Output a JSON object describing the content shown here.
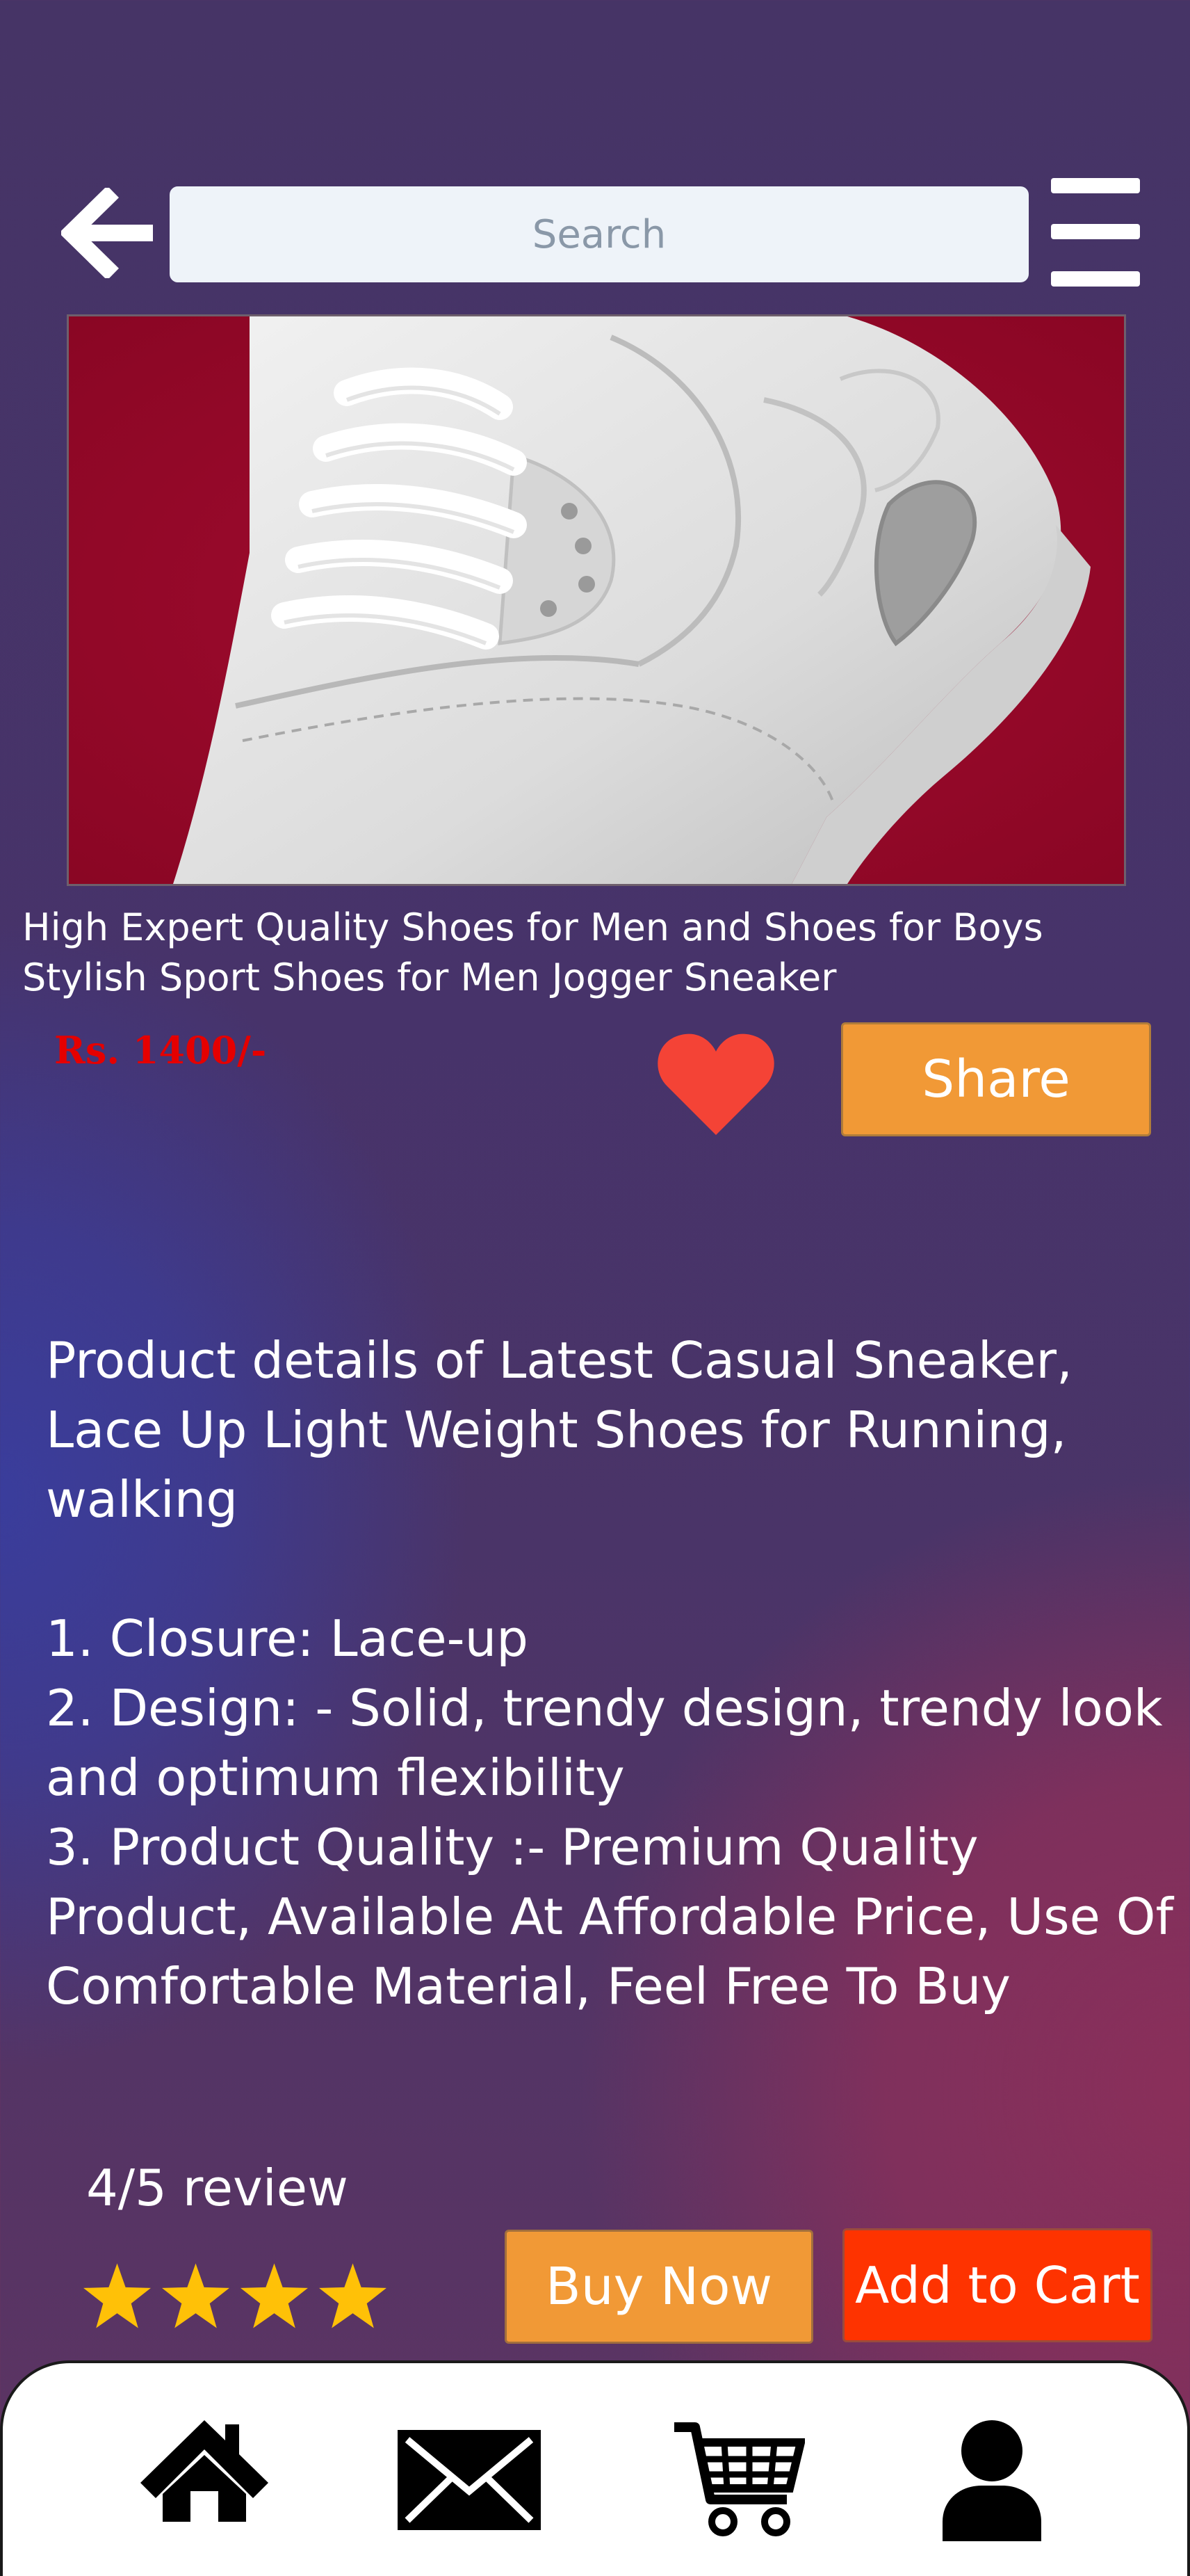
{
  "header": {
    "back_icon": "arrow-left-icon",
    "search_placeholder": "Search",
    "menu_icon": "hamburger-menu-icon"
  },
  "product": {
    "image": "white-sneaker-on-red-background",
    "title": "High Expert Quality Shoes for Men and Shoes for Boys Stylish Sport Shoes for Men Jogger Sneaker",
    "price": "Rs. 1400/-",
    "favorite_icon": "heart-icon",
    "share_label": "Share"
  },
  "details": {
    "intro": "Product details of Latest Casual Sneaker, Lace Up Light Weight Shoes for Running, walking",
    "points": [
      "1. Closure: Lace-up",
      "2. Design: - Solid, trendy design, trendy look and optimum flexibility",
      "3. Product Quality :- Premium Quality Product, Available At Affordable Price, Use Of Comfortable Material, Feel Free To Buy"
    ]
  },
  "review": {
    "text": "4/5 review",
    "rating": 4,
    "max_rating": 5
  },
  "actions": {
    "buy_now_label": "Buy Now",
    "add_to_cart_label": "Add to Cart"
  },
  "bottom_nav": {
    "items": [
      {
        "icon": "home-icon"
      },
      {
        "icon": "mail-icon"
      },
      {
        "icon": "cart-icon"
      },
      {
        "icon": "user-icon"
      }
    ]
  },
  "colors": {
    "accent_orange": "#f19936",
    "add_to_cart_red": "#fe3300",
    "price_red": "#e50000",
    "star_yellow": "#ffc107",
    "heart_red": "#f44336"
  }
}
